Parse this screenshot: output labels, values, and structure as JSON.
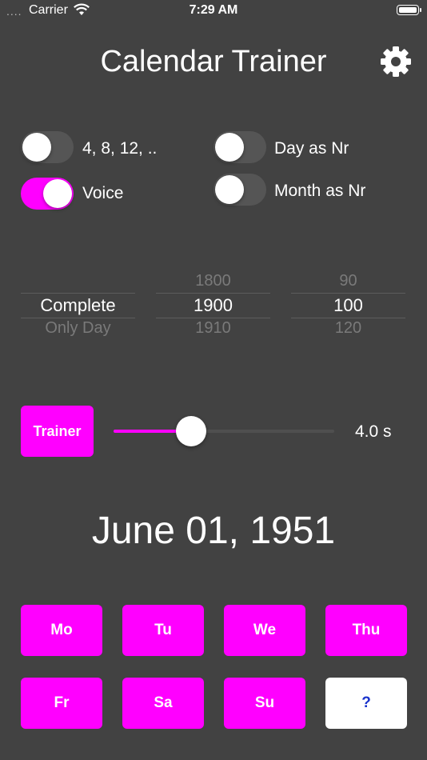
{
  "status_bar": {
    "signal": "....",
    "carrier": "Carrier",
    "time": "7:29 AM"
  },
  "header": {
    "title": "Calendar Trainer"
  },
  "toggles": {
    "multiples": {
      "label": "4, 8, 12, ..",
      "on": false
    },
    "voice": {
      "label": "Voice",
      "on": true
    },
    "day_as_nr": {
      "label": "Day as Nr",
      "on": false
    },
    "month_as_nr": {
      "label": "Month as Nr",
      "on": false
    }
  },
  "pickers": {
    "mode": {
      "above": "",
      "selected": "Complete",
      "below": "Only Day"
    },
    "start_year": {
      "above": "1800",
      "selected": "1900",
      "below": "1910"
    },
    "range": {
      "above": "90",
      "selected": "100",
      "below": "120"
    }
  },
  "trainer": {
    "button_label": "Trainer",
    "interval_label": "4.0 s",
    "slider_fraction": 0.35
  },
  "date_display": "June 01, 1951",
  "days": [
    "Mo",
    "Tu",
    "We",
    "Thu",
    "Fr",
    "Sa",
    "Su",
    "?"
  ],
  "colors": {
    "accent": "#ff00ff",
    "background": "#424242",
    "question_text": "#1a33cc"
  }
}
